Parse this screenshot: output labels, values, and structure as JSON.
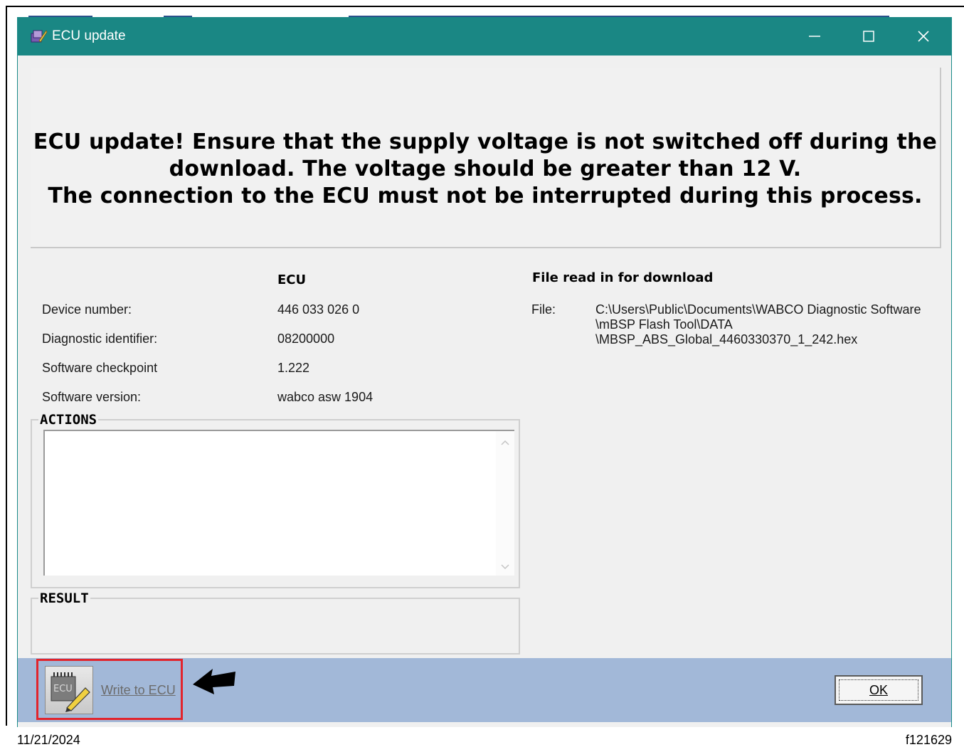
{
  "window": {
    "title": "ECU update",
    "controls": {
      "minimize": "minimize-icon",
      "maximize": "maximize-icon",
      "close": "close-icon"
    }
  },
  "warning": {
    "text": "ECU update! Ensure that the supply voltage is not switched off during the\ndownload. The voltage should be greater than 12 V.\nThe connection to the ECU must not be interrupted during this process."
  },
  "ecu": {
    "column_header": "ECU",
    "rows": [
      {
        "label": "Device number:",
        "value": "446 033 026 0"
      },
      {
        "label": "Diagnostic identifier:",
        "value": "08200000"
      },
      {
        "label": "Software checkpoint",
        "value": "1.222"
      },
      {
        "label": "Software version:",
        "value": "wabco asw 1904"
      }
    ]
  },
  "file_panel": {
    "header": "File read in for download",
    "label": "File:",
    "path_lines": [
      "C:\\Users\\Public\\Documents\\WABCO Diagnostic Software",
      "\\mBSP Flash Tool\\DATA",
      "\\MBSP_ABS_Global_4460330370_1_242.hex"
    ]
  },
  "actions": {
    "legend": "ACTIONS",
    "content": ""
  },
  "result": {
    "legend": "RESULT",
    "content": ""
  },
  "toolbar": {
    "write_label": "Write to ECU",
    "ok_label": "OK",
    "icon_text": "ECU"
  },
  "footer": {
    "date": "11/21/2024",
    "figure_id": "f121629"
  },
  "colors": {
    "titlebar": "#1a8784",
    "bottom_bar": "#a2b8d8",
    "highlight": "#e2242c"
  }
}
